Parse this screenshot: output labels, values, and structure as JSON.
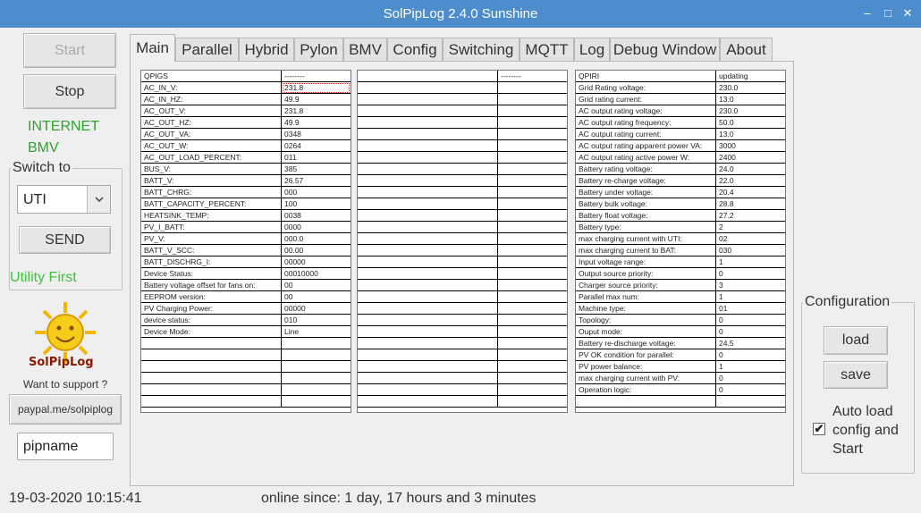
{
  "window": {
    "title": "SolPipLog 2.4.0 Sunshine",
    "minimize": "–",
    "maximize": "□",
    "close": "✕"
  },
  "left": {
    "start_label": "Start",
    "stop_label": "Stop",
    "internet_label": "INTERNET",
    "bmv_label": "BMV",
    "switch_to_title": "Switch to",
    "switch_select_value": "UTI",
    "send_label": "SEND",
    "mode_label": "Utility First",
    "logo_text": "SolPipLog",
    "support_text": "Want to support ?",
    "paypal_label": "paypal.me/solpiplog",
    "pipname_value": "pipname"
  },
  "tabs": [
    "Main",
    "Parallel",
    "Hybrid",
    "Pylon",
    "BMV",
    "Config",
    "Switching",
    "MQTT",
    "Log",
    "Debug Window",
    "About"
  ],
  "qpigs_table": {
    "rows": [
      [
        "QPIGS",
        "--------"
      ],
      [
        "AC_IN_V:",
        "231.8"
      ],
      [
        "AC_IN_HZ:",
        "49.9"
      ],
      [
        "AC_OUT_V:",
        "231.8"
      ],
      [
        "AC_OUT_HZ:",
        "49.9"
      ],
      [
        "AC_OUT_VA:",
        "0348"
      ],
      [
        "AC_OUT_W:",
        "0264"
      ],
      [
        "AC_OUT_LOAD_PERCENT:",
        "011"
      ],
      [
        "BUS_V:",
        "385"
      ],
      [
        "BATT_V:",
        "26.57"
      ],
      [
        "BATT_CHRG:",
        "000"
      ],
      [
        "BATT_CAPACITY_PERCENT:",
        "100"
      ],
      [
        "HEATSINK_TEMP:",
        "0038"
      ],
      [
        "PV_I_BATT:",
        "0000"
      ],
      [
        "PV_V:",
        "000.0"
      ],
      [
        "BATT_V_SCC:",
        "00.00"
      ],
      [
        "BATT_DISCHRG_I:",
        "00000"
      ],
      [
        "Device Status:",
        "00010000"
      ],
      [
        "Battery voltage offset for fans on:",
        "00"
      ],
      [
        "EEPROM version:",
        "00"
      ],
      [
        "PV Charging Power:",
        "00000"
      ],
      [
        "device status:",
        "010"
      ],
      [
        "Device Mode:",
        "Line"
      ],
      [
        "",
        ""
      ],
      [
        "",
        ""
      ],
      [
        "",
        ""
      ],
      [
        "",
        ""
      ],
      [
        "",
        ""
      ],
      [
        "",
        ""
      ]
    ]
  },
  "middle_table": {
    "rows": [
      [
        "",
        "--------"
      ],
      [
        "",
        ""
      ],
      [
        "",
        ""
      ],
      [
        "",
        ""
      ],
      [
        "",
        ""
      ],
      [
        "",
        ""
      ],
      [
        "",
        ""
      ],
      [
        "",
        ""
      ],
      [
        "",
        ""
      ],
      [
        "",
        ""
      ],
      [
        "",
        ""
      ],
      [
        "",
        ""
      ],
      [
        "",
        ""
      ],
      [
        "",
        ""
      ],
      [
        "",
        ""
      ],
      [
        "",
        ""
      ],
      [
        "",
        ""
      ],
      [
        "",
        ""
      ],
      [
        "",
        ""
      ],
      [
        "",
        ""
      ],
      [
        "",
        ""
      ],
      [
        "",
        ""
      ],
      [
        "",
        ""
      ],
      [
        "",
        ""
      ],
      [
        "",
        ""
      ],
      [
        "",
        ""
      ],
      [
        "",
        ""
      ],
      [
        "",
        ""
      ],
      [
        "",
        ""
      ]
    ]
  },
  "qpiri_table": {
    "rows": [
      [
        "QPIRI",
        "updating"
      ],
      [
        "Grid Rating voltage:",
        "230.0"
      ],
      [
        "Grid rating current:",
        "13.0"
      ],
      [
        "AC output rating voltage:",
        "230.0"
      ],
      [
        "AC output rating frequency:",
        "50.0"
      ],
      [
        "AC output rating current:",
        "13.0"
      ],
      [
        "AC output rating apparent power VA:",
        "3000"
      ],
      [
        "AC output rating active power W:",
        "2400"
      ],
      [
        "Battery rating voltage:",
        "24.0"
      ],
      [
        "Battery re-charge voltage:",
        "22.0"
      ],
      [
        "Battery under voltage:",
        "20.4"
      ],
      [
        "Battery bulk voltage:",
        "28.8"
      ],
      [
        "Battery float voltage:",
        "27.2"
      ],
      [
        "Battery type:",
        "2"
      ],
      [
        "max charging current with UTI:",
        "02"
      ],
      [
        "max charging current to BAT:",
        "030"
      ],
      [
        "Input voltage range:",
        "1"
      ],
      [
        "Output source priority:",
        "0"
      ],
      [
        "Charger source priority:",
        "3"
      ],
      [
        "Parallel max num:",
        "1"
      ],
      [
        "Machine type:",
        "01"
      ],
      [
        "Topology:",
        "0"
      ],
      [
        "Ouput mode:",
        "0"
      ],
      [
        "Battery re-discharge voltage:",
        "24.5"
      ],
      [
        "PV OK condition for parallel:",
        "0"
      ],
      [
        "PV power balance:",
        "1"
      ],
      [
        "max charging current with PV:",
        "0"
      ],
      [
        "Operation logic:",
        "0"
      ],
      [
        "",
        ""
      ]
    ]
  },
  "config": {
    "title": "Configuration",
    "load_label": "load",
    "save_label": "save",
    "auto_load_line1": "Auto load",
    "auto_load_line2": "config and",
    "auto_load_line3": "Start",
    "auto_load_checked": "✔"
  },
  "status": {
    "datetime": "19-03-2020 10:15:41",
    "online": "online since: 1 day, 17 hours  and 3 minutes"
  }
}
